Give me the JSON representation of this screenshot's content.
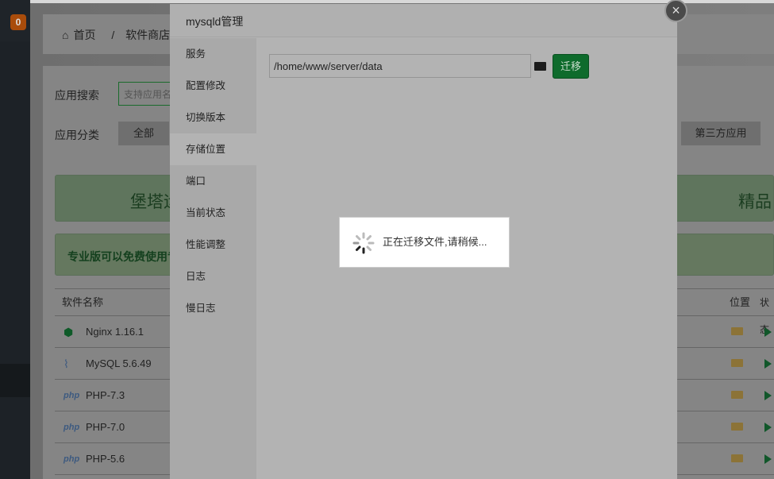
{
  "sidebar": {
    "badge": "0"
  },
  "breadcrumb": {
    "home": "首页",
    "separator": "/",
    "current": "软件商店"
  },
  "filters": {
    "search_label": "应用搜索",
    "search_placeholder": "支持应用名",
    "category_label": "应用分类",
    "categories": [
      "全部",
      "第三方应用"
    ]
  },
  "banners": {
    "b1_left": "堡塔运",
    "b1_right": "精品",
    "b2": "专业版可以免费使用专"
  },
  "table": {
    "headers": {
      "name": "软件名称",
      "location": "位置",
      "status": "状态"
    },
    "rows": [
      {
        "icon": "nginx-icon",
        "name": "Nginx 1.16.1"
      },
      {
        "icon": "mysql-icon",
        "name": "MySQL 5.6.49"
      },
      {
        "icon": "php-icon",
        "name": "PHP-7.3"
      },
      {
        "icon": "php-icon",
        "name": "PHP-7.0"
      },
      {
        "icon": "php-icon",
        "name": "PHP-5.6"
      }
    ]
  },
  "modal": {
    "title": "mysqld管理",
    "menu": [
      "服务",
      "配置修改",
      "切换版本",
      "存储位置",
      "端口",
      "当前状态",
      "性能调整",
      "日志",
      "慢日志"
    ],
    "selected": "存储位置",
    "path_value": "/home/www/server/data",
    "migrate_button": "迁移",
    "close": "×"
  },
  "loading": {
    "text": "正在迁移文件,请稍候..."
  }
}
